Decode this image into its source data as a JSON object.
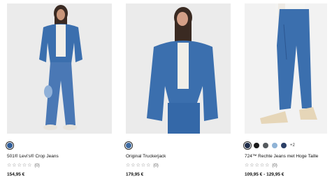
{
  "products": [
    {
      "name": "501® Levi's® Crop Jeans",
      "price": "154,95 €",
      "rating_count": "(0)",
      "stars": 5,
      "swatches": [
        {
          "color": "#2f5d9a",
          "selected": true
        }
      ]
    },
    {
      "name": "Original Truckerjack",
      "price": "179,95 €",
      "rating_count": "(0)",
      "stars": 5,
      "swatches": [
        {
          "color": "#3d6aa2",
          "selected": true
        }
      ]
    },
    {
      "name": "724™ Rechte Jeans met Hoge Taille",
      "price": "109,95 € - 129,95 €",
      "rating_count": "(0)",
      "stars": 5,
      "swatches": [
        {
          "color": "#1f2d4a",
          "selected": true
        },
        {
          "color": "#1a1a1a",
          "selected": false
        },
        {
          "color": "#555a5e",
          "selected": false
        },
        {
          "color": "#8fb3d6",
          "selected": false
        },
        {
          "color": "#2b3f66",
          "selected": false
        }
      ],
      "more_colors": "+2"
    }
  ],
  "colors": {
    "denim": "#3b6fae",
    "denim_dark": "#2c5690",
    "image_bg": "#ebebeb"
  }
}
